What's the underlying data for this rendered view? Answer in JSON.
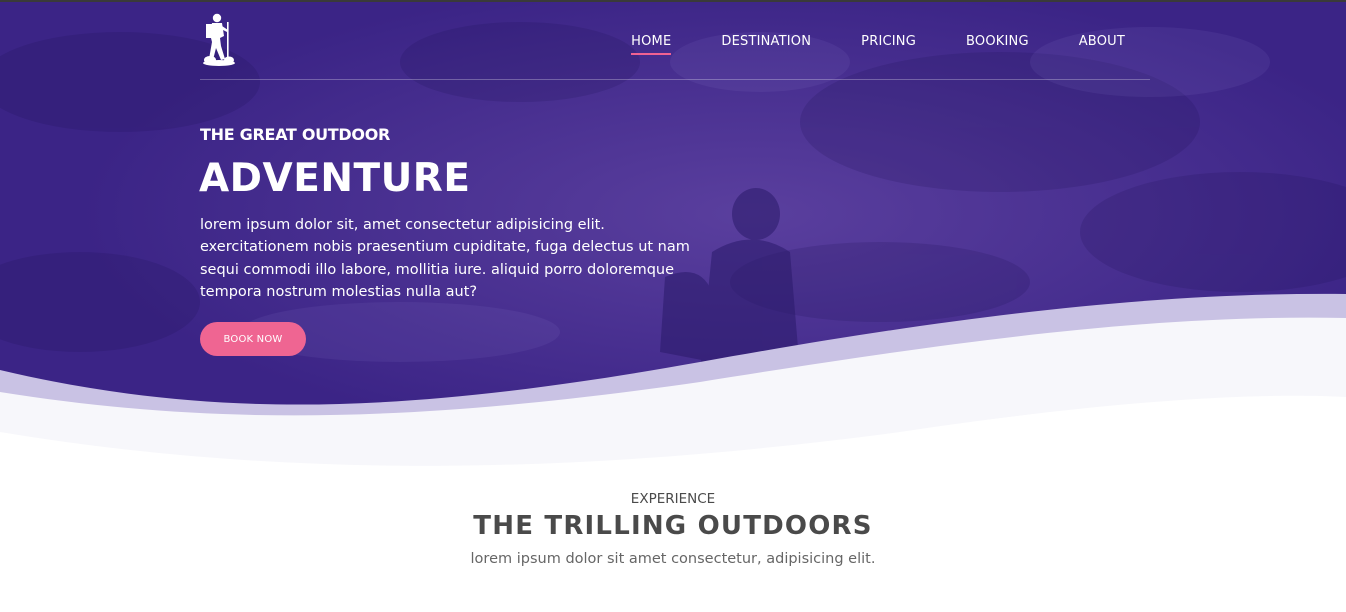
{
  "colors": {
    "hero_overlay": "#3b2486",
    "wave_light": "#c9c2e4",
    "accent": "#ef6592",
    "heading_dark": "#4a4a4a"
  },
  "brand": {
    "logo_icon": "hiker-icon"
  },
  "nav": {
    "items": [
      {
        "label": "HOME",
        "active": true
      },
      {
        "label": "DESTINATION",
        "active": false
      },
      {
        "label": "PRICING",
        "active": false
      },
      {
        "label": "BOOKING",
        "active": false
      },
      {
        "label": "ABOUT",
        "active": false
      }
    ]
  },
  "hero": {
    "eyebrow": "THE GREAT OUTDOOR",
    "title": "ADVENTURE",
    "text": "lorem ipsum dolor sit, amet consectetur adipisicing elit. exercitationem nobis praesentium cupiditate, fuga delectus ut nam sequi commodi illo labore, mollitia iure. aliquid porro doloremque tempora nostrum molestias nulla aut?",
    "button_label": "BOOK NOW"
  },
  "experience": {
    "eyebrow": "EXPERIENCE",
    "title": "THE TRILLING OUTDOORS",
    "subtitle": "lorem ipsum dolor sit amet consectetur, adipisicing elit."
  }
}
